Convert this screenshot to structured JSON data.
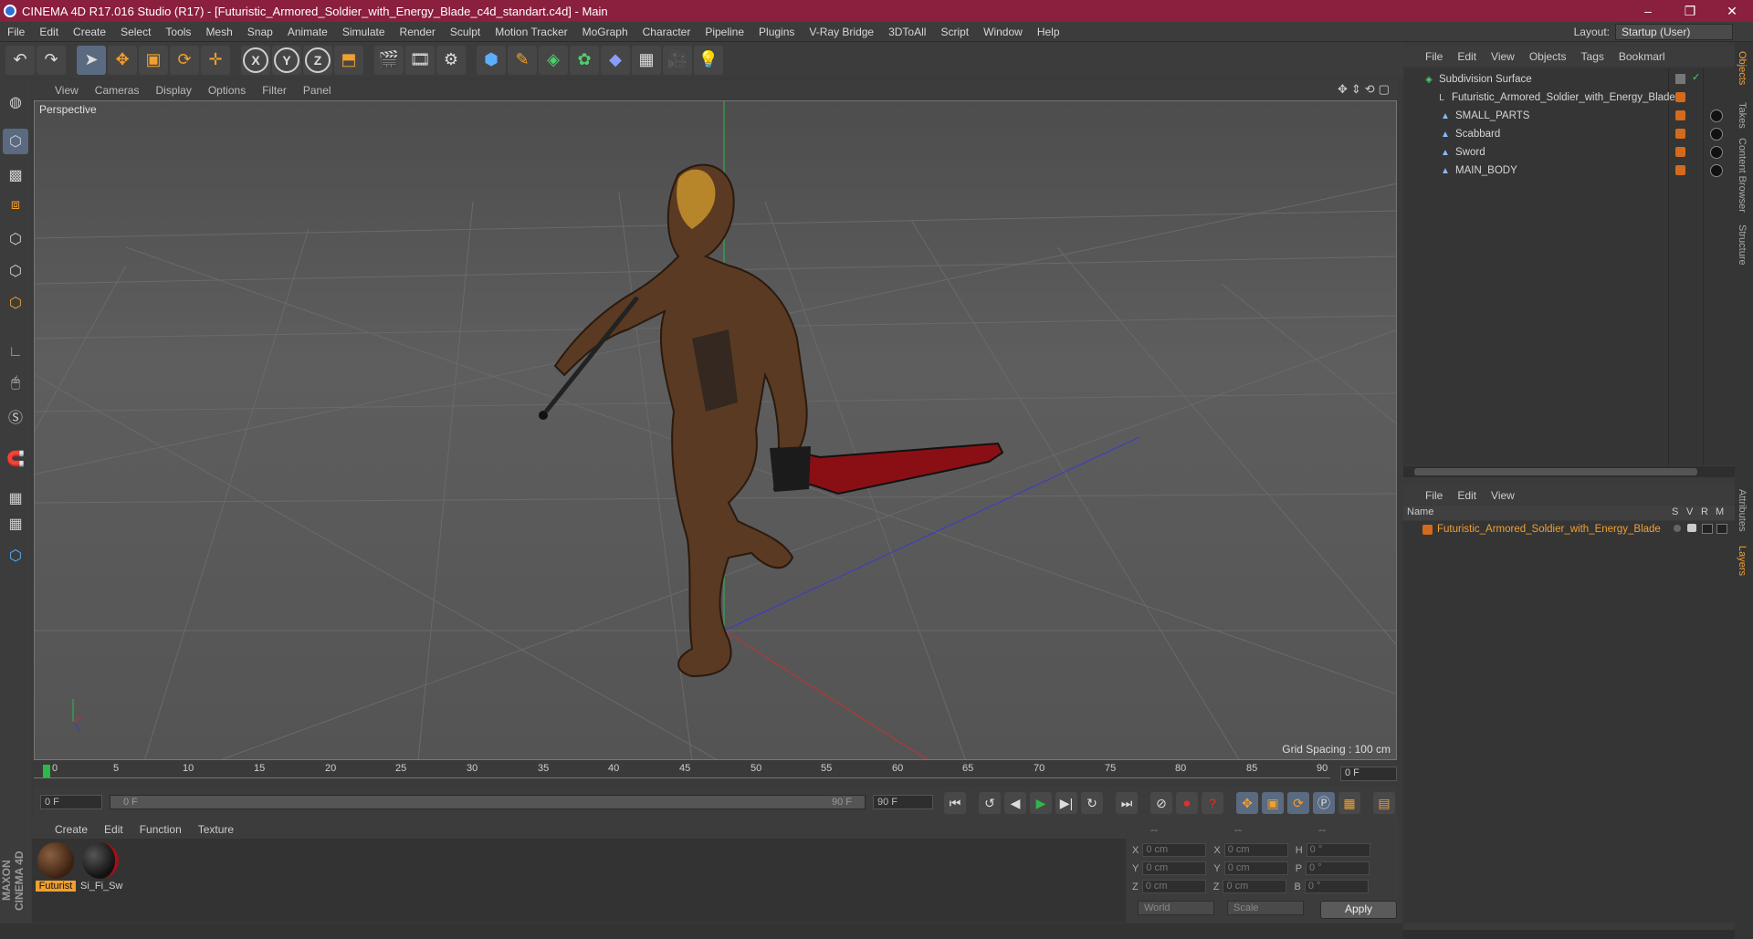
{
  "app": {
    "title": "CINEMA 4D R17.016 Studio (R17) - [Futuristic_Armored_Soldier_with_Energy_Blade_c4d_standart.c4d] - Main",
    "window_buttons": [
      "–",
      "❐",
      "✕"
    ]
  },
  "menubar": {
    "items": [
      "File",
      "Edit",
      "Create",
      "Select",
      "Tools",
      "Mesh",
      "Snap",
      "Animate",
      "Simulate",
      "Render",
      "Sculpt",
      "Motion Tracker",
      "MoGraph",
      "Character",
      "Pipeline",
      "Plugins",
      "V-Ray Bridge",
      "3DToAll",
      "Script",
      "Window",
      "Help"
    ],
    "layout_label": "Layout:",
    "layout_value": "Startup (User)"
  },
  "toolbar": {
    "axis_x": "X",
    "axis_y": "Y",
    "axis_z": "Z"
  },
  "viewport": {
    "menu": [
      "View",
      "Cameras",
      "Display",
      "Options",
      "Filter",
      "Panel"
    ],
    "camera_label": "Perspective",
    "grid_spacing": "Grid Spacing : 100 cm",
    "nav_icons": "✥⇕⟲▢"
  },
  "timeline": {
    "ticks": [
      "0",
      "5",
      "10",
      "15",
      "20",
      "25",
      "30",
      "35",
      "40",
      "45",
      "50",
      "55",
      "60",
      "65",
      "70",
      "75",
      "80",
      "85",
      "90"
    ],
    "current_frame": "0 F",
    "start_field": "0 F",
    "range_start": "0 F",
    "range_end": "90 F",
    "end_field": "90 F"
  },
  "material_manager": {
    "menu": [
      "Create",
      "Edit",
      "Function",
      "Texture"
    ],
    "materials": [
      {
        "label": "Futurist",
        "selected": true
      },
      {
        "label": "Si_Fi_Sw",
        "selected": false
      }
    ],
    "brand_text": "MAXON CINEMA 4D"
  },
  "coordinates": {
    "headers": [
      "--",
      "--",
      "--"
    ],
    "rows": [
      {
        "a": "X",
        "av": "0 cm",
        "b": "X",
        "bv": "0 cm",
        "c": "H",
        "cv": "0 °"
      },
      {
        "a": "Y",
        "av": "0 cm",
        "b": "Y",
        "bv": "0 cm",
        "c": "P",
        "cv": "0 °"
      },
      {
        "a": "Z",
        "av": "0 cm",
        "b": "Z",
        "bv": "0 cm",
        "c": "B",
        "cv": "0 °"
      }
    ],
    "mode_world": "World",
    "mode_scale": "Scale",
    "apply_label": "Apply"
  },
  "object_manager": {
    "menu": [
      "File",
      "Edit",
      "View",
      "Objects",
      "Tags",
      "Bookmarl"
    ],
    "objects": [
      {
        "name": "Subdivision Surface",
        "depth": 0
      },
      {
        "name": "Futuristic_Armored_Soldier_with_Energy_Blade",
        "depth": 1
      },
      {
        "name": "SMALL_PARTS",
        "depth": 2
      },
      {
        "name": "Scabbard",
        "depth": 2
      },
      {
        "name": "Sword",
        "depth": 2
      },
      {
        "name": "MAIN_BODY",
        "depth": 2
      }
    ]
  },
  "layer_manager": {
    "menu": [
      "File",
      "Edit",
      "View"
    ],
    "columns": {
      "name": "Name",
      "s": "S",
      "v": "V",
      "r": "R",
      "m": "M"
    },
    "layers": [
      {
        "name": "Futuristic_Armored_Soldier_with_Energy_Blade"
      }
    ]
  },
  "side_tabs": [
    "Objects",
    "Takes",
    "Content Browser",
    "Structure",
    "Attributes",
    "Layers"
  ],
  "colors": {
    "titlebar": "#8a1f3e",
    "accent_orange": "#d46a1e",
    "layer_text": "#f0a030"
  }
}
